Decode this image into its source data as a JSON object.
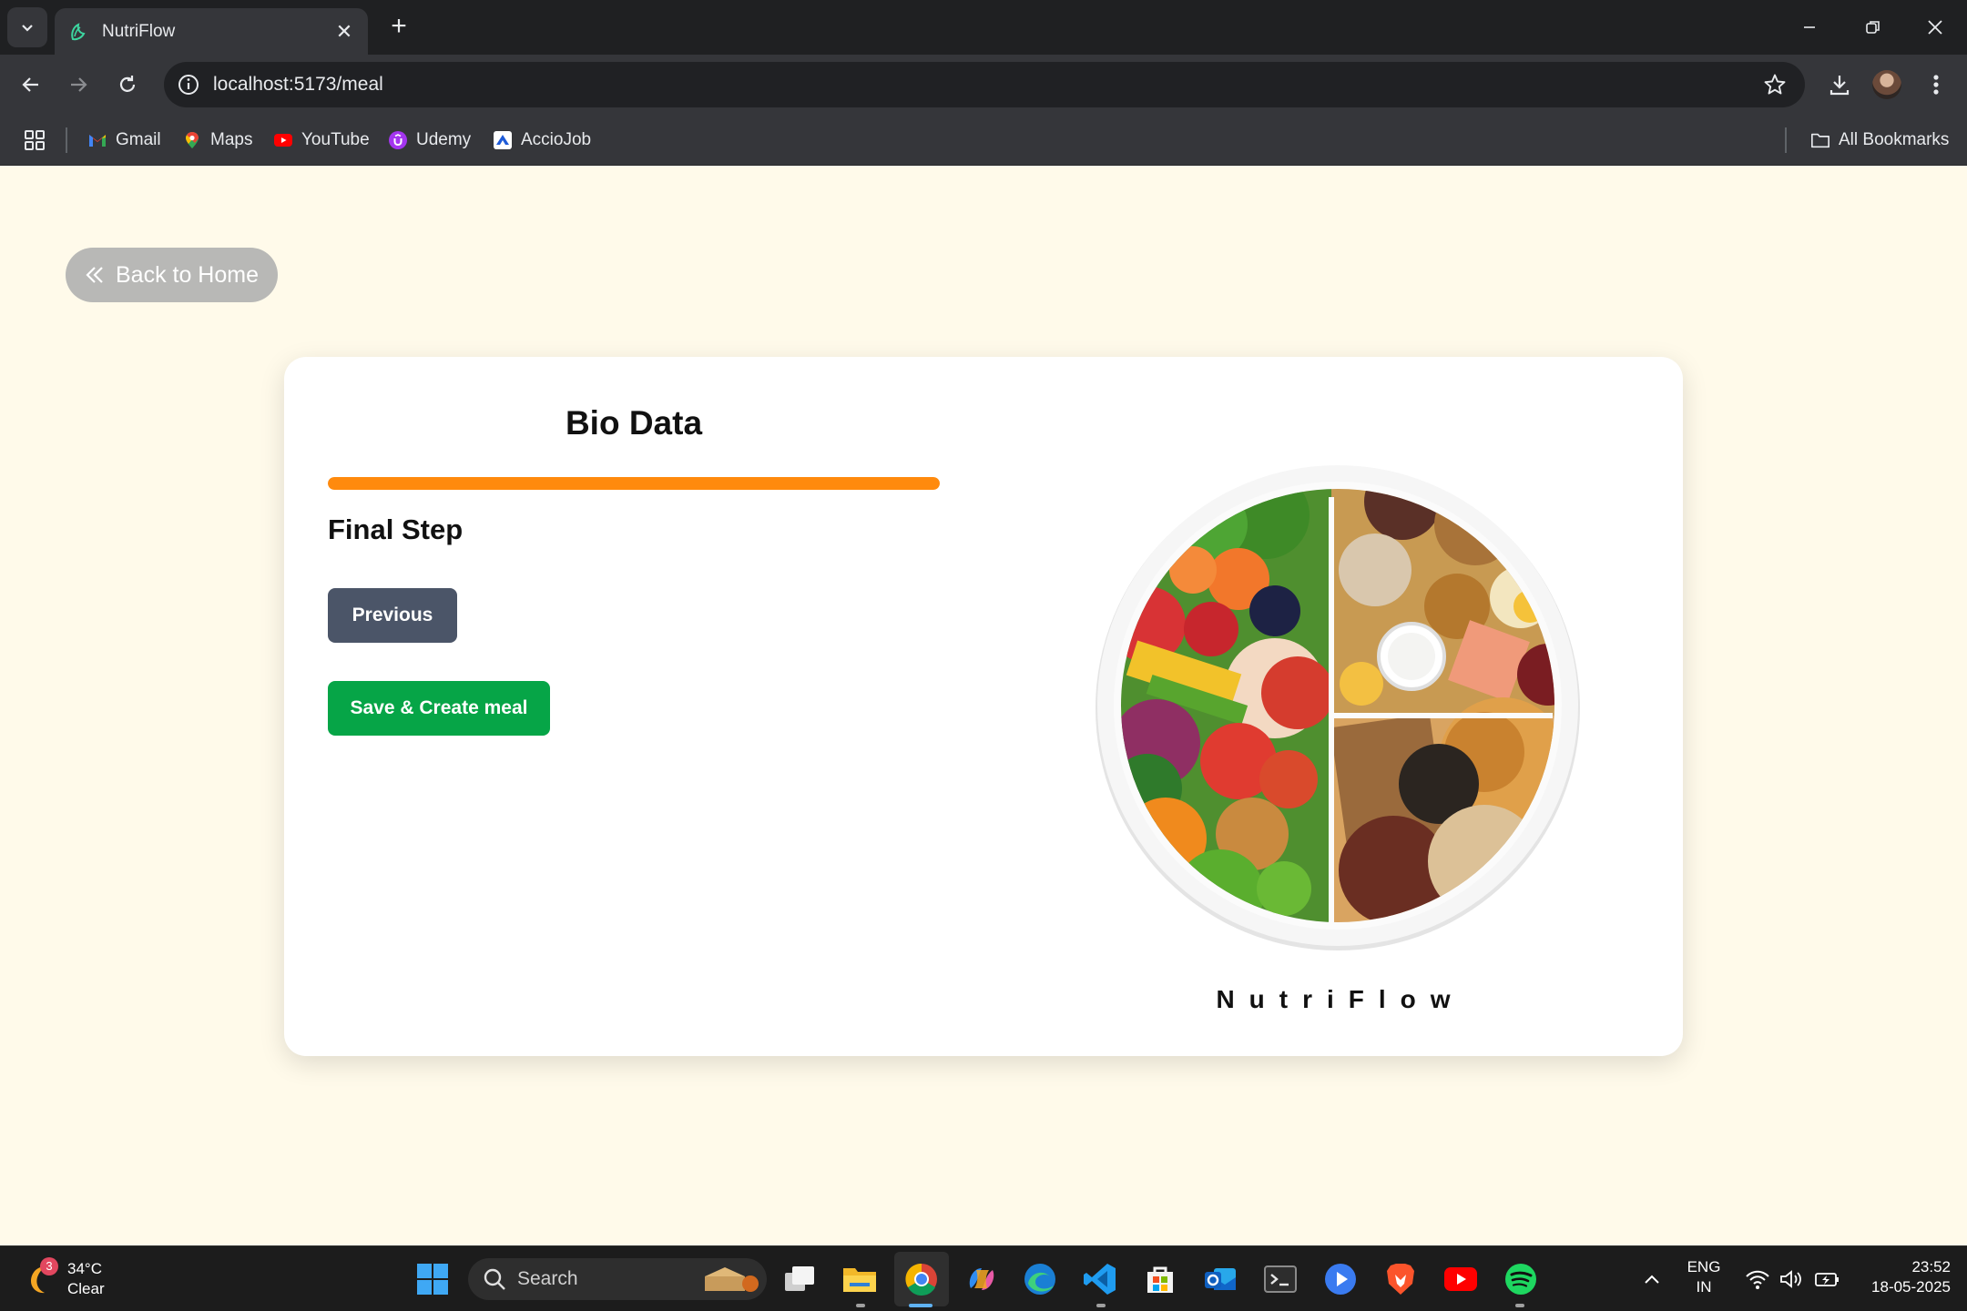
{
  "browser": {
    "tab_title": "NutriFlow",
    "url": "localhost:5173/meal",
    "bookmarks": [
      {
        "label": "Gmail",
        "icon": "gmail-icon"
      },
      {
        "label": "Maps",
        "icon": "maps-icon"
      },
      {
        "label": "YouTube",
        "icon": "youtube-icon"
      },
      {
        "label": "Udemy",
        "icon": "udemy-icon"
      },
      {
        "label": "AccioJob",
        "icon": "acciojob-icon"
      }
    ],
    "all_bookmarks_label": "All Bookmarks"
  },
  "page": {
    "back_label": "Back to Home",
    "card_title": "Bio Data",
    "progress": 1.0,
    "progress_color": "#ff8a0d",
    "step_label": "Final Step",
    "previous_label": "Previous",
    "save_label": "Save & Create meal",
    "brand": "NutriFlow",
    "colors": {
      "background": "#fffaea",
      "previous_button": "#4b5568",
      "save_button": "#06a547",
      "back_button": "#b8b8b6"
    }
  },
  "taskbar": {
    "weather_temp": "34°C",
    "weather_desc": "Clear",
    "weather_badge": "3",
    "search_placeholder": "Search",
    "lang_top": "ENG",
    "lang_bottom": "IN",
    "time": "23:52",
    "date": "18-05-2025"
  }
}
